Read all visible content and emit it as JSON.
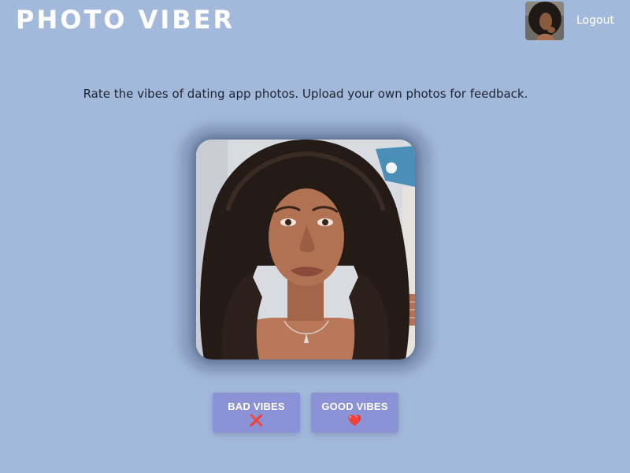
{
  "header": {
    "title": "PHOTO VIBER",
    "logout_label": "Logout",
    "avatar_icon": "user-avatar-photo"
  },
  "main": {
    "tagline": "Rate the vibes of dating app photos. Upload your own photos for feedback.",
    "photo_icon": "portrait-photo"
  },
  "actions": {
    "bad": {
      "label": "BAD VIBES",
      "icon": "❌"
    },
    "good": {
      "label": "GOOD VIBES",
      "icon": "❤️"
    }
  },
  "colors": {
    "background": "#a3b9db",
    "button": "#8c92d6",
    "bad_icon": "#d81e1e",
    "good_icon": "#e3243a"
  }
}
